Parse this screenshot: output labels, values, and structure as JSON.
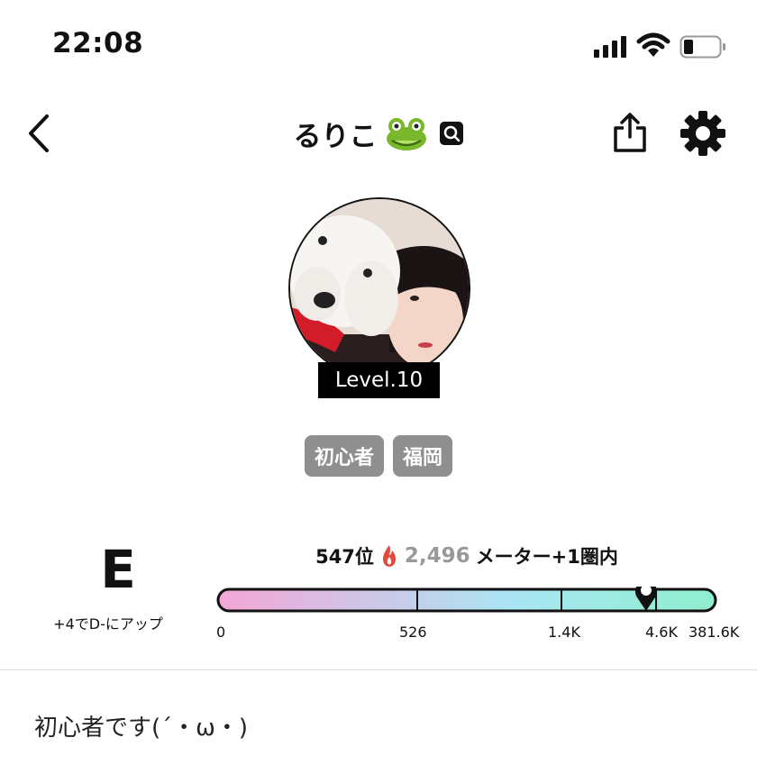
{
  "status_bar": {
    "time": "22:08"
  },
  "header": {
    "title": "るりこ",
    "icons": [
      "back-chevron-icon",
      "frog-emoji-icon",
      "search-badge-icon",
      "share-icon",
      "gear-icon"
    ]
  },
  "profile": {
    "level": "Level.10",
    "tags": [
      "初心者",
      "福岡"
    ]
  },
  "rank": {
    "grade": "E",
    "grade_note": "+4でD-にアップ",
    "position": "547位",
    "points": "2,496",
    "extra": "メーター+1圏内",
    "meter_value": 2496,
    "meter_ticks": [
      "0",
      "526",
      "1.4K",
      "4.6K",
      "381.6K"
    ],
    "gradient": [
      "#f4a6d7",
      "#a9e6f4",
      "#8eeecd"
    ]
  },
  "bio": {
    "text": "初心者です(´・ω・)"
  }
}
